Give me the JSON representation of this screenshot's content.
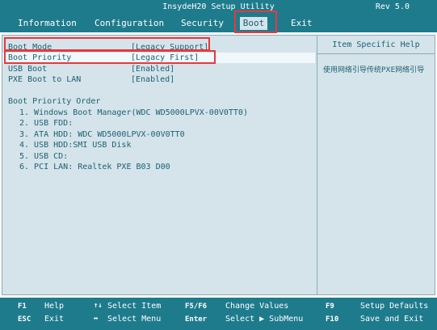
{
  "window": {
    "title": "InsydeH20 Setup Utility",
    "revision": "Rev 5.0"
  },
  "menu": {
    "tabs": [
      {
        "label": "Information"
      },
      {
        "label": "Configuration"
      },
      {
        "label": "Security"
      },
      {
        "label": "Boot",
        "active": true
      },
      {
        "label": "Exit"
      }
    ]
  },
  "settings": [
    {
      "label": "Boot Mode",
      "value": "[Legacy Support]"
    },
    {
      "label": "Boot Priority",
      "value": "[Legacy First]"
    },
    {
      "label": "USB Boot",
      "value": "[Enabled]"
    },
    {
      "label": "PXE Boot to LAN",
      "value": "[Enabled]"
    }
  ],
  "boot_order": {
    "heading": "Boot Priority Order",
    "items": [
      "1. Windows Boot Manager(WDC WD5000LPVX-00V0TT0)",
      "2. USB FDD:",
      "3. ATA HDD: WDC WD5000LPVX-00V0TT0",
      "4. USB HDD:SMI USB Disk",
      "5. USB CD:",
      "6. PCI LAN: Realtek PXE B03 D00"
    ]
  },
  "help": {
    "title": "Item Specific Help",
    "text": "使用网络引导传统PXE网络引导"
  },
  "footer": {
    "row1": [
      {
        "key": "F1",
        "desc": "Help"
      },
      {
        "key": "↑↓",
        "desc": "Select Item"
      },
      {
        "key": "F5/F6",
        "desc": "Change Values"
      },
      {
        "key": "F9",
        "desc": "Setup Defaults"
      }
    ],
    "row2": [
      {
        "key": "ESC",
        "desc": "Exit"
      },
      {
        "key": "↔",
        "desc": "Select Menu"
      },
      {
        "key": "Enter",
        "desc": "Select ▶ SubMenu"
      },
      {
        "key": "F10",
        "desc": "Save and Exit"
      }
    ]
  },
  "colors": {
    "bar": "#1e7b8c",
    "panel": "#d4e4ea",
    "text": "#1e5f72",
    "highlight": "#e8383d",
    "selected": "#f0f8fc"
  }
}
